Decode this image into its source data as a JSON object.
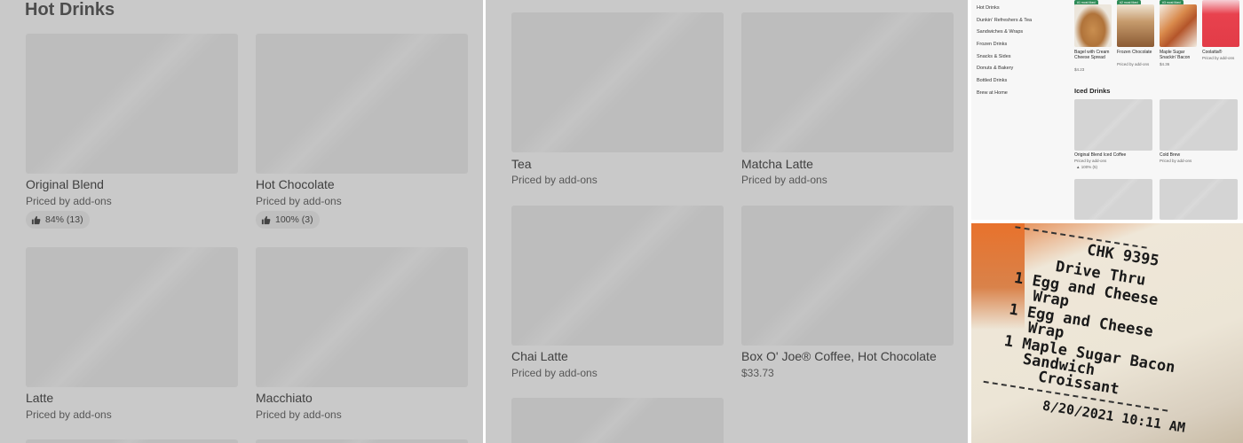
{
  "panel_left": {
    "section_title": "Hot Drinks",
    "items": [
      {
        "name": "Original Blend",
        "price": "Priced by add-ons",
        "rating": "84% (13)"
      },
      {
        "name": "Hot Chocolate",
        "price": "Priced by add-ons",
        "rating": "100% (3)"
      },
      {
        "name": "Latte",
        "price": "Priced by add-ons"
      },
      {
        "name": "Macchiato",
        "price": "Priced by add-ons"
      }
    ]
  },
  "panel_middle": {
    "items": [
      {
        "name": "Tea",
        "price": "Priced by add-ons"
      },
      {
        "name": "Matcha Latte",
        "price": "Priced by add-ons"
      },
      {
        "name": "Chai Latte",
        "price": "Priced by add-ons"
      },
      {
        "name": "Box O' Joe® Coffee, Hot Chocolate",
        "price": "$33.73"
      }
    ]
  },
  "app_screenshot": {
    "nav": [
      "Hot Drinks",
      "Dunkin' Refreshers & Tea",
      "Sandwiches & Wraps",
      "Frozen Drinks",
      "Snacks & Sides",
      "Donuts & Bakery",
      "Bottled Drinks",
      "Brew at Home"
    ],
    "featured": [
      {
        "badge": "#1 most liked",
        "name": "Bagel with Cream Cheese Spread",
        "price": "$4.23"
      },
      {
        "badge": "#2 most liked",
        "name": "Frozen Chocolate",
        "price": "Priced by add-ons"
      },
      {
        "badge": "#3 most liked",
        "name": "Maple Sugar Snackin' Bacon",
        "price": "$4.36"
      },
      {
        "badge": "",
        "name": "Coolatta®",
        "price": "Priced by add-ons"
      }
    ],
    "section_heading": "Iced Drinks",
    "iced": [
      {
        "name": "Original Blend Iced Coffee",
        "price": "Priced by add-ons",
        "rating": "100% (5)"
      },
      {
        "name": "Cold Brew",
        "price": "Priced by add-ons"
      }
    ],
    "popular_badge": "Popular"
  },
  "receipt": {
    "lines": [
      "CHK 9395",
      "Drive Thru",
      "1 Egg and Cheese",
      "Wrap",
      "1 Egg and Cheese",
      "Wrap",
      "1 Maple Sugar Bacon",
      "Sandwich",
      "Croissant",
      "8/20/2021 10:11 AM"
    ]
  },
  "colors": {
    "badge_green": "#2e8b57",
    "receipt_orange": "#e8722c"
  },
  "icons": {
    "rating": "thumbs-up-icon"
  }
}
